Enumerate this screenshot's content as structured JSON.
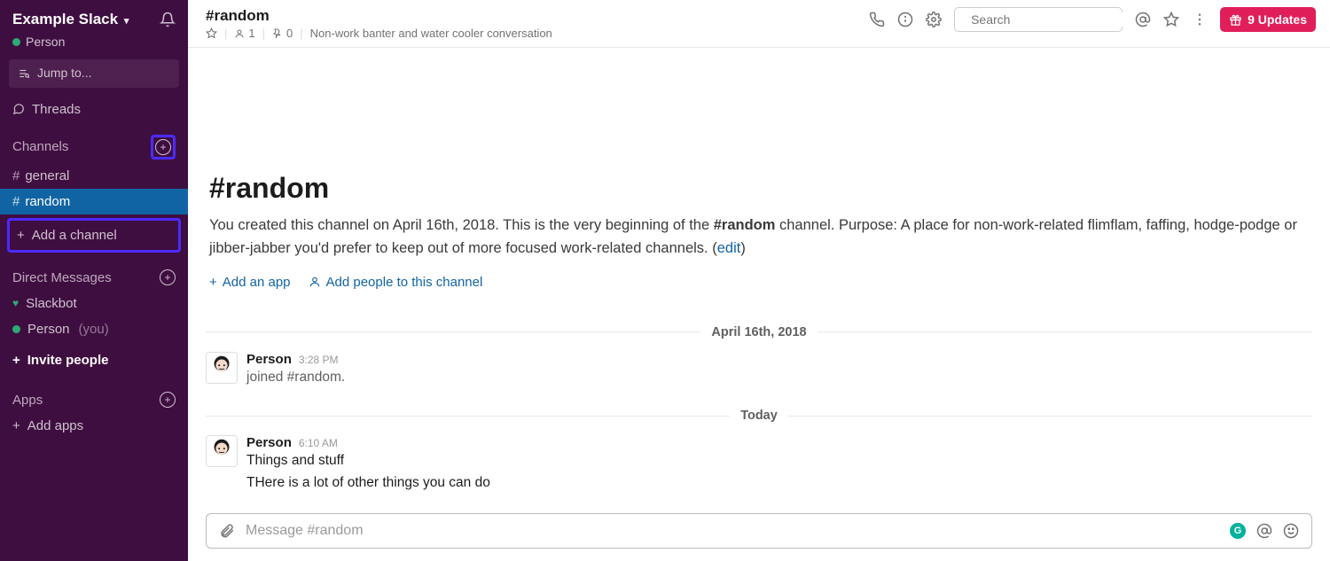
{
  "workspace": {
    "name": "Example Slack",
    "user": "Person",
    "jump_placeholder": "Jump to...",
    "threads_label": "Threads"
  },
  "sidebar": {
    "channels_header": "Channels",
    "channels": [
      {
        "name": "general",
        "active": false
      },
      {
        "name": "random",
        "active": true
      }
    ],
    "add_channel_label": "Add a channel",
    "dm_header": "Direct Messages",
    "dms": [
      {
        "name": "Slackbot",
        "type": "bot"
      },
      {
        "name": "Person",
        "you_suffix": "(you)",
        "type": "self"
      }
    ],
    "invite_label": "Invite people",
    "apps_header": "Apps",
    "add_apps_label": "Add apps"
  },
  "header": {
    "channel_title": "#random",
    "star_count": "",
    "member_icon_label": "1",
    "pin_count": "0",
    "topic": "Non-work banter and water cooler conversation",
    "search_placeholder": "Search",
    "updates_label": "9 Updates"
  },
  "intro": {
    "title": "#random",
    "text_prefix": "You created this channel on April 16th, 2018. This is the very beginning of the ",
    "channel_bold": "#random",
    "text_mid": " channel. Purpose: A place for non-work-related flimflam, faffing, hodge-podge or jibber-jabber you'd prefer to keep out of more focused work-related channels. (",
    "edit_label": "edit",
    "text_suffix": ")",
    "add_app_label": "Add an app",
    "add_people_label": "Add people to this channel"
  },
  "dividers": {
    "d1": "April 16th, 2018",
    "d2": "Today"
  },
  "messages": {
    "m1": {
      "sender": "Person",
      "time": "3:28 PM",
      "text": "joined #random."
    },
    "m2": {
      "sender": "Person",
      "time": "6:10 AM",
      "text1": "Things and stuff",
      "text2": "THere is a lot of other things you can do"
    }
  },
  "composer": {
    "placeholder": "Message #random"
  }
}
